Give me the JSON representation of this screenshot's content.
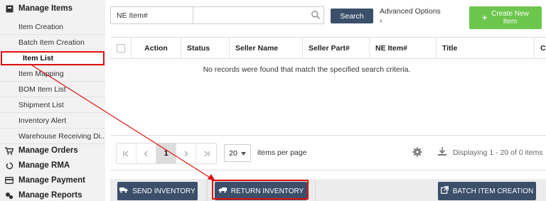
{
  "sidebar": {
    "sections": [
      {
        "label": "Manage Items",
        "icon": "box-icon"
      },
      {
        "label": "Manage Orders",
        "icon": "cart-icon"
      },
      {
        "label": "Manage RMA",
        "icon": "recycle-icon"
      },
      {
        "label": "Manage Payment",
        "icon": "credit-card-icon"
      },
      {
        "label": "Manage Reports",
        "icon": "reports-icon"
      }
    ],
    "items": [
      {
        "label": "Item Creation"
      },
      {
        "label": "Batch Item Creation"
      },
      {
        "label": "Item List",
        "active": true
      },
      {
        "label": "Item Mapping"
      },
      {
        "label": "BOM Item List"
      },
      {
        "label": "Shipment List"
      },
      {
        "label": "Inventory Alert"
      },
      {
        "label": "Warehouse Receiving Di..."
      }
    ]
  },
  "search": {
    "field_label": "NE Item#",
    "value": "",
    "button_label": "Search",
    "advanced_label": "Advanced Options",
    "advanced_chevron": "›"
  },
  "create_button": {
    "line1": "Create New",
    "line2": "Item",
    "icon": "plus-icon"
  },
  "table": {
    "columns": [
      "Action",
      "Status",
      "Seller Name",
      "Seller Part#",
      "NE Item#",
      "Title",
      "C"
    ],
    "empty_message": "No records were found that match the specified search criteria."
  },
  "pager": {
    "current_page": "1",
    "page_size": "20",
    "items_per_page_label": "items per page",
    "info": "Displaying 1 - 20 of 0 items"
  },
  "footer": {
    "send_inventory": "SEND INVENTORY",
    "return_inventory": "RETURN INVENTORY",
    "batch_item_creation": "BATCH ITEM CREATION"
  },
  "colors": {
    "primary_button": "#3b4f6a",
    "create_button": "#6cc64b",
    "highlight": "#e01010"
  }
}
